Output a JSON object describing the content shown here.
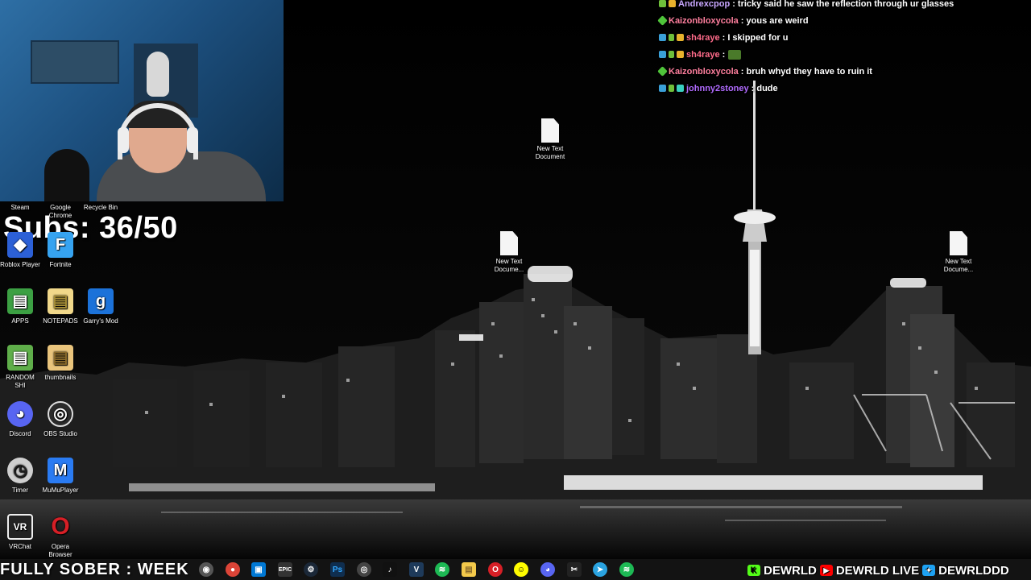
{
  "webcam": {},
  "subs_counter": "Subs: 36/50",
  "desktop_icons": [
    {
      "label": "Steam",
      "color": "#1b2838"
    },
    {
      "label": "Google Chrome",
      "color": "#db4437"
    },
    {
      "label": "Recycle Bin",
      "color": "#8aa0b8"
    },
    {
      "label": "Roblox Player",
      "color": "#2c60d6"
    },
    {
      "label": "Fortnite",
      "color": "#36a3f0"
    },
    {
      "label": "APPS",
      "color": "#3ca043"
    },
    {
      "label": "NOTEPADS",
      "color": "#f1d88a"
    },
    {
      "label": "Garry's Mod",
      "color": "#1c72d9"
    },
    {
      "label": "RANDOM SHI",
      "color": "#5fae4a"
    },
    {
      "label": "thumbnails",
      "color": "#e9c47c"
    },
    {
      "label": "Discord",
      "color": "#5865f2"
    },
    {
      "label": "OBS Studio",
      "color": "#2b2b2b"
    },
    {
      "label": "Timer",
      "color": "#cfcfcf"
    },
    {
      "label": "MuMuPlayer",
      "color": "#2a7bf2"
    },
    {
      "label": "VRChat",
      "color": "#222222"
    },
    {
      "label": "Opera Browser",
      "color": "#d61f26"
    }
  ],
  "text_documents": [
    {
      "label": "New Text Document"
    },
    {
      "label": "New Text Docume..."
    },
    {
      "label": "New Text Docume..."
    }
  ],
  "chat": [
    {
      "user": "Andrexcpop",
      "user_color": "#c9a7ff",
      "message": ": tricky said he saw the reflection through ur glasses"
    },
    {
      "user": "Kaizonbloxycola",
      "user_color": "#ff7f9e",
      "message": ": yous are weird"
    },
    {
      "user": "sh4raye",
      "user_color": "#ff6b8a",
      "message": ": I skipped for u"
    },
    {
      "user": "sh4raye",
      "user_color": "#ff6b8a",
      "message": ":"
    },
    {
      "user": "Kaizonbloxycola",
      "user_color": "#ff7f9e",
      "message": ": bruh whyd they have to ruin it"
    },
    {
      "user": "johnny2stoney",
      "user_color": "#b16bff",
      "message": ": dude"
    }
  ],
  "ticker": "FULLY SOBER : WEEK",
  "socials": {
    "kick": "DEWRLD",
    "youtube": "DEWRLD LIVE",
    "twitter": "DEWRLDDD"
  },
  "taskbar_icons": [
    "obs-icon",
    "chrome-icon",
    "store-icon",
    "epic-icon",
    "steam-icon",
    "photoshop-icon",
    "obs-recording-icon",
    "tiktok-icon",
    "vegas-icon",
    "spotify-icon",
    "explorer-icon",
    "opera-icon",
    "snapchat-icon",
    "discord-icon",
    "capcut-icon",
    "telegram-icon",
    "spotify-icon-2"
  ]
}
